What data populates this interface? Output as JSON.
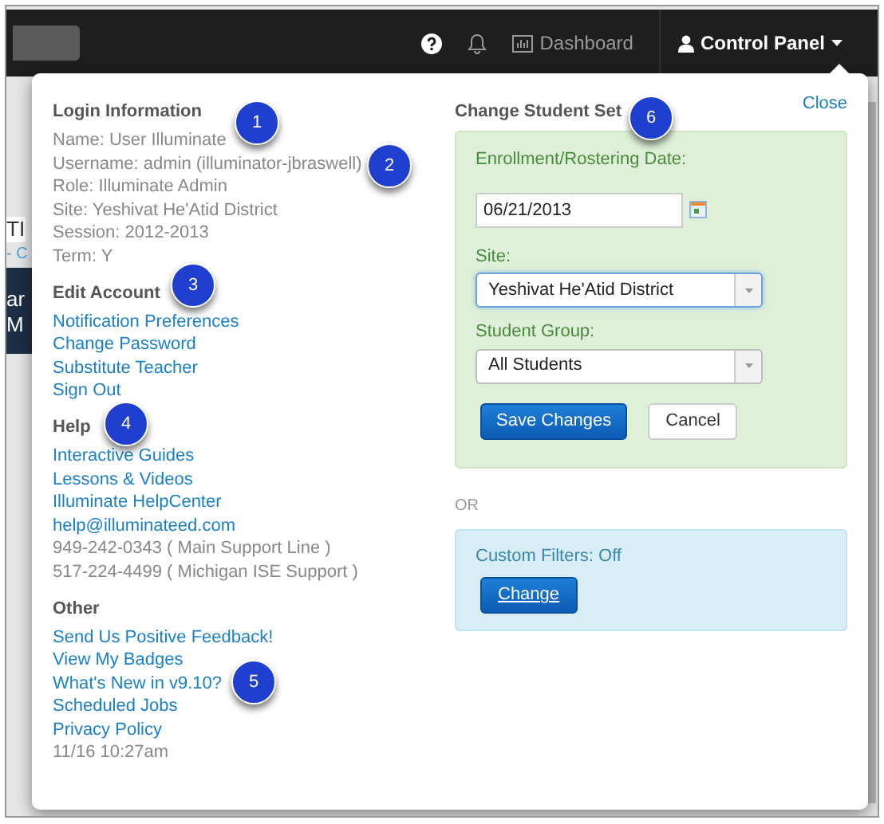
{
  "navbar": {
    "items": [
      {
        "kind": "help"
      },
      {
        "kind": "bell"
      },
      {
        "kind": "dashboard",
        "label": "Dashboard"
      },
      {
        "kind": "menu",
        "label": "Control Panel"
      }
    ]
  },
  "background_fragments": [
    {
      "text": "TI",
      "kind": "plain"
    },
    {
      "text": "- C",
      "kind": "link"
    },
    {
      "text": "ar",
      "kind": "banner"
    },
    {
      "text": "M",
      "kind": "banner"
    }
  ],
  "popover": {
    "close": "Close",
    "left_sections": [
      {
        "heading": "Login Information",
        "items": [
          {
            "text": "Name: User Illuminate",
            "kind": "info"
          },
          {
            "text": "Username: admin (illuminator-jbraswell)",
            "kind": "info"
          },
          {
            "text": "Role: Illuminate Admin",
            "kind": "info"
          },
          {
            "text": "Site: Yeshivat He'Atid District",
            "kind": "info"
          },
          {
            "text": "Session: 2012-2013",
            "kind": "info"
          },
          {
            "text": "Term: Y",
            "kind": "info"
          }
        ]
      },
      {
        "heading": "Edit Account",
        "items": [
          {
            "text": "Notification Preferences",
            "kind": "link"
          },
          {
            "text": "Change Password",
            "kind": "link"
          },
          {
            "text": "Substitute Teacher",
            "kind": "link"
          },
          {
            "text": "Sign Out",
            "kind": "link"
          }
        ]
      },
      {
        "heading": "Help",
        "items": [
          {
            "text": "Interactive Guides",
            "kind": "link"
          },
          {
            "text": "Lessons & Videos",
            "kind": "link"
          },
          {
            "text": "Illuminate HelpCenter",
            "kind": "link"
          },
          {
            "text": "help@illuminateed.com",
            "kind": "link"
          },
          {
            "text": "949-242-0343 ( Main Support Line )",
            "kind": "info"
          },
          {
            "text": "517-224-4499 ( Michigan ISE Support )",
            "kind": "info"
          }
        ]
      },
      {
        "heading": "Other",
        "items": [
          {
            "text": "Send Us Positive Feedback!",
            "kind": "link"
          },
          {
            "text": "View My Badges",
            "kind": "link"
          },
          {
            "text": "What's New in v9.10?",
            "kind": "link"
          },
          {
            "text": "Scheduled Jobs",
            "kind": "link"
          },
          {
            "text": "Privacy Policy",
            "kind": "link"
          },
          {
            "text": "11/16 10:27am",
            "kind": "info"
          }
        ]
      }
    ],
    "change_student_set": {
      "heading": "Change Student Set",
      "date_label": "Enrollment/Rostering Date:",
      "date_value": "06/21/2013",
      "site_label": "Site:",
      "site_value": "Yeshivat He'Atid District",
      "site_focused": true,
      "group_label": "Student Group:",
      "group_value": "All Students",
      "group_focused": false,
      "save": "Save Changes",
      "cancel": "Cancel"
    },
    "or": "OR",
    "custom_filters": {
      "label": "Custom Filters: Off",
      "button": "Change"
    }
  },
  "callouts": [
    {
      "number": "1"
    },
    {
      "number": "2"
    },
    {
      "number": "3"
    },
    {
      "number": "4"
    },
    {
      "number": "5"
    },
    {
      "number": "6"
    }
  ]
}
